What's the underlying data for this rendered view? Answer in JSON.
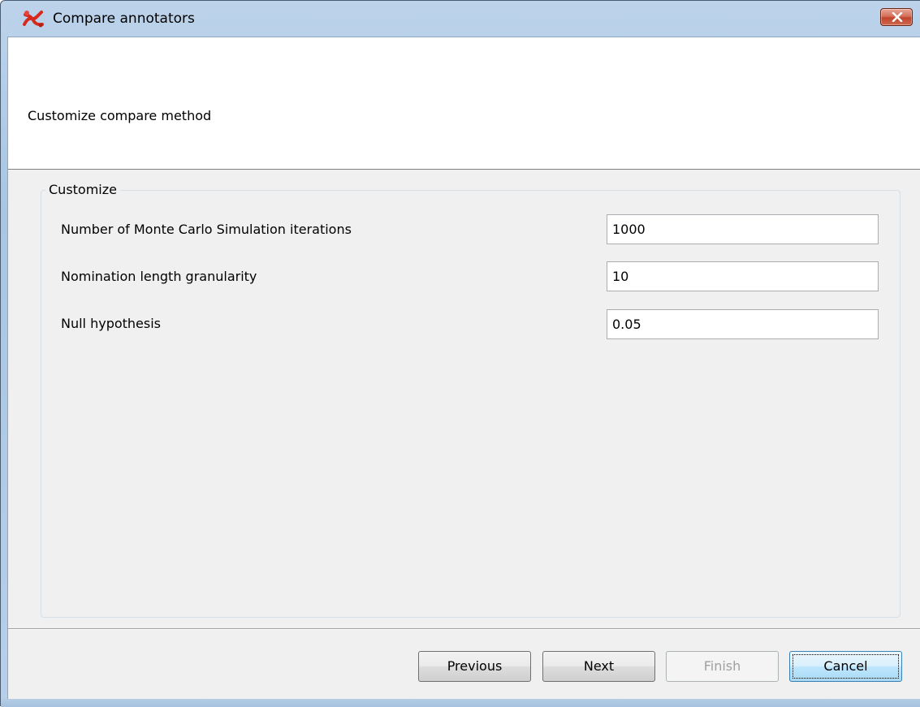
{
  "window": {
    "title": "Compare annotators"
  },
  "header": {
    "text": "Customize compare method"
  },
  "group": {
    "title": "Customize",
    "fields": [
      {
        "label": "Number of Monte Carlo Simulation iterations",
        "value": "1000"
      },
      {
        "label": "Nomination length granularity",
        "value": "10"
      },
      {
        "label": "Null hypothesis",
        "value": "0.05"
      }
    ]
  },
  "buttons": {
    "previous": "Previous",
    "next": "Next",
    "finish": "Finish",
    "cancel": "Cancel"
  },
  "icons": {
    "app": "app-logo-icon",
    "close": "close-icon"
  },
  "colors": {
    "close_button": "#c1442c",
    "app_icon": "#d62a1e"
  }
}
